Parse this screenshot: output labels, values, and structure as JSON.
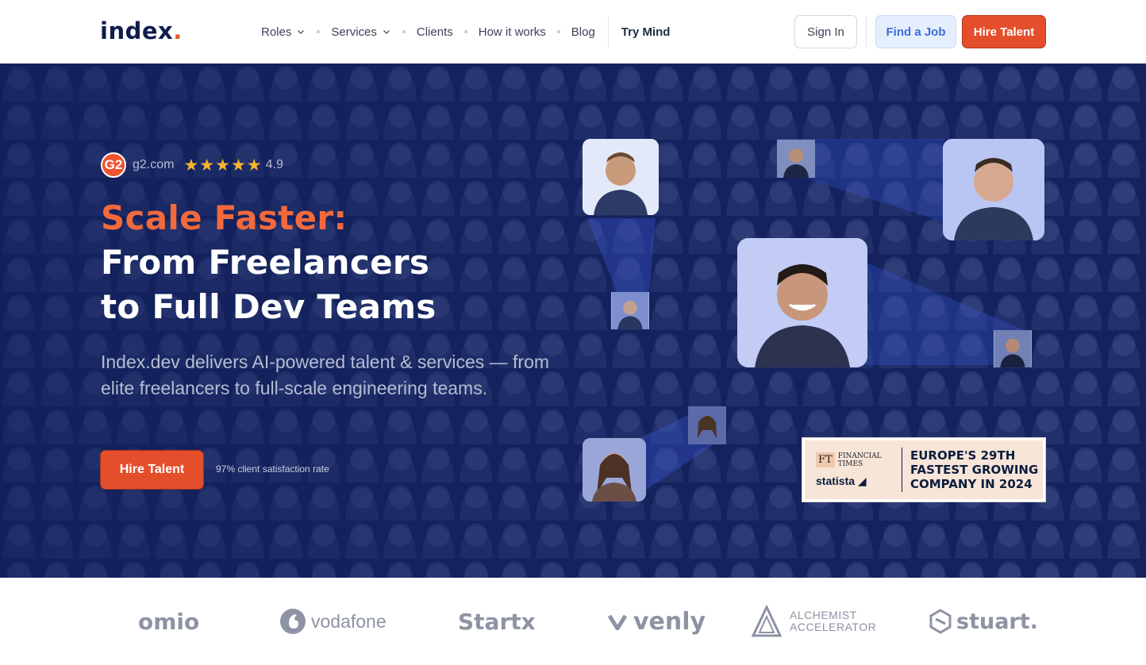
{
  "header": {
    "logo_text": "index",
    "logo_dot": ".",
    "nav": [
      {
        "label": "Roles"
      },
      {
        "label": "Services"
      },
      {
        "label": "Clients"
      },
      {
        "label": "How it works"
      },
      {
        "label": "Blog"
      }
    ],
    "try_mind": "Try Mind",
    "sign_in": "Sign In",
    "find_job": "Find a Job",
    "hire_talent": "Hire Talent"
  },
  "hero": {
    "rating_site": "g2.com",
    "rating_score": "4.9",
    "rating_stars": 5,
    "g2_mark": "G2",
    "headline_1": "Scale Faster:",
    "headline_2": "From Freelancers",
    "headline_3": "to Full Dev Teams",
    "subheadline": "Index.dev delivers AI-powered talent & services — from elite freelancers to full-scale engineering teams.",
    "cta": "Hire Talent",
    "satisfaction": "97% client satisfaction rate",
    "badge": {
      "ft_mark": "FT",
      "ft_name_1": "FINANCIAL",
      "ft_name_2": "TIMES",
      "statista": "statista",
      "line_1": "EUROPE'S 29TH",
      "line_2": "FASTEST GROWING",
      "line_3": "COMPANY IN 2024"
    }
  },
  "client_logos": {
    "omio": "omio",
    "vodafone": "vodafone",
    "startx": "Startx",
    "venly": "venly",
    "alchemist_1": "ALCHEMIST",
    "alchemist_2": "ACCELERATOR",
    "stuart": "stuart."
  },
  "colors": {
    "brand_orange": "#e54e2b",
    "hero_navy": "#14235e",
    "accent_blue": "#3b6fd9"
  }
}
